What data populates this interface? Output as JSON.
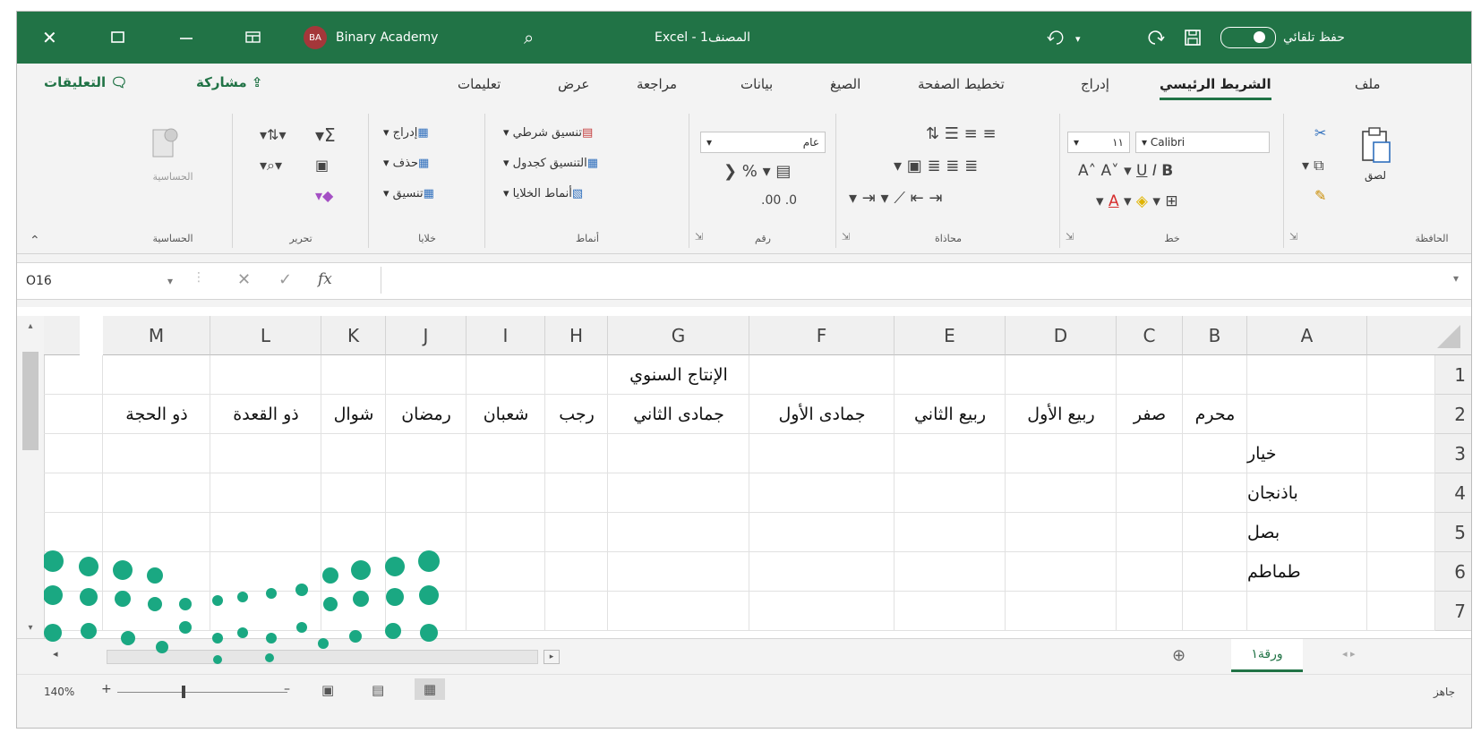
{
  "titlebar": {
    "close_glyph": "✕",
    "user_initials": "BA",
    "user_name": "Binary Academy",
    "search_glyph": "⌕",
    "app_title": "Excel - المصنف1",
    "autosave_label": "حفظ تلقائي"
  },
  "tabs": [
    "ملف",
    "الشريط الرئيسي",
    "إدراج",
    "تخطيط الصفحة",
    "الصيغ",
    "بيانات",
    "مراجعة",
    "عرض",
    "تعليمات"
  ],
  "active_tab": "الشريط الرئيسي",
  "share_label": "مشاركة",
  "comments_label": "التعليقات",
  "ribbon": {
    "clipboard": {
      "label": "الحافظة",
      "paste_label": "لصق"
    },
    "font": {
      "label": "خط",
      "font_name": "Calibri",
      "font_size": "١١"
    },
    "alignment": {
      "label": "محاذاة"
    },
    "number": {
      "label": "رقم",
      "format": "عام"
    },
    "styles": {
      "label": "أنماط",
      "conditional": "تنسيق شرطي",
      "as_table": "التنسيق كجدول",
      "cell_styles": "أنماط الخلايا"
    },
    "cells": {
      "label": "خلايا",
      "insert": "إدراج",
      "delete": "حذف",
      "format": "تنسيق"
    },
    "editing": {
      "label": "تحرير"
    },
    "sensitivity": {
      "label": "الحساسية",
      "button": "الحساسية"
    }
  },
  "formula_bar": {
    "name_box": "O16",
    "cancel": "✕",
    "enter": "✓",
    "fx": "fx"
  },
  "columns": [
    "A",
    "B",
    "C",
    "D",
    "E",
    "F",
    "G",
    "H",
    "I",
    "J",
    "K",
    "L",
    "M"
  ],
  "rows": [
    "1",
    "2",
    "3",
    "4",
    "5",
    "6",
    "7"
  ],
  "sheet": {
    "title": "الإنتاج السنوي",
    "months": [
      "محرم",
      "صفر",
      "ربيع الأول",
      "ربيع الثاني",
      "جمادى الأول",
      "جمادى الثاني",
      "رجب",
      "شعبان",
      "رمضان",
      "شوال",
      "ذو القعدة",
      "ذو الحجة"
    ],
    "products": [
      "خيار",
      "باذنجان",
      "بصل",
      "طماطم"
    ]
  },
  "sheet_tab": "ورقة١",
  "status": {
    "ready": "جاهز",
    "zoom": "140%"
  },
  "colors": {
    "brand": "#217346",
    "logo": "#1aa882"
  }
}
